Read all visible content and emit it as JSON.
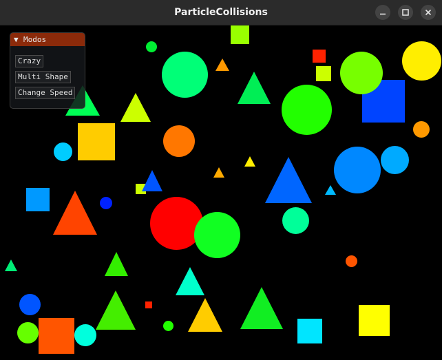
{
  "window": {
    "title": "ParticleCollisions",
    "controls": [
      "minimize-icon",
      "maximize-icon",
      "close-icon"
    ]
  },
  "panel": {
    "title": "Modos",
    "collapse_icon": "triangle-down-icon",
    "buttons": [
      {
        "label": "Crazy"
      },
      {
        "label": "Multi Shape"
      },
      {
        "label": "Change Speed"
      }
    ]
  },
  "colors": {
    "titlebar": "#2b2b2b",
    "canvas": "#000000",
    "panel_header": "#8b2a0a"
  }
}
